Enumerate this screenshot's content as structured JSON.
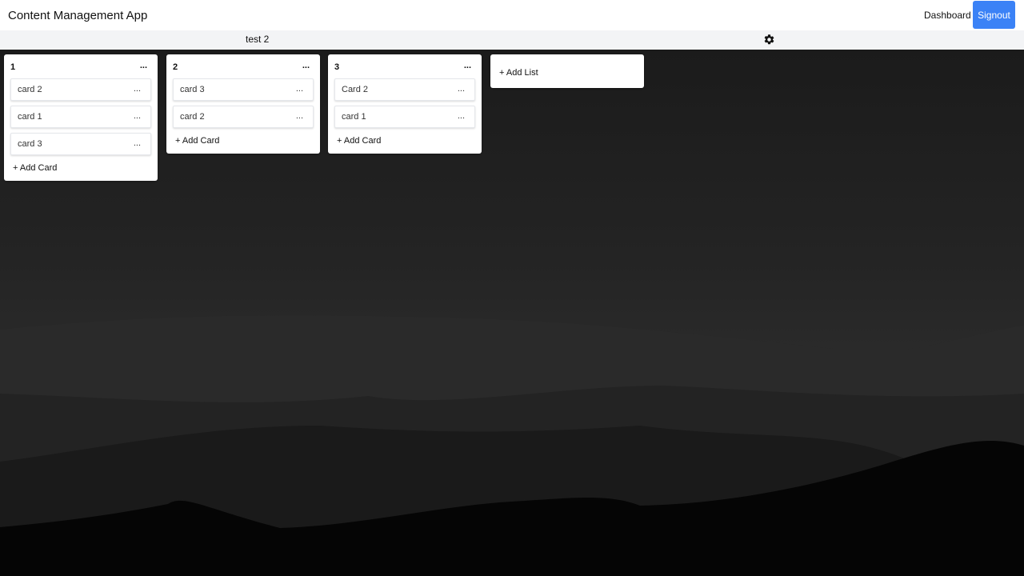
{
  "app": {
    "title": "Content Management App"
  },
  "nav": {
    "dashboard": "Dashboard",
    "signout": "Signout"
  },
  "board": {
    "name": "test 2",
    "settings_icon": "gear-icon"
  },
  "lists": [
    {
      "title": "1",
      "menu": "...",
      "cards": [
        {
          "title": "card 2",
          "menu": "..."
        },
        {
          "title": "card 1",
          "menu": "..."
        },
        {
          "title": "card 3",
          "menu": "..."
        }
      ],
      "add_card": "+ Add Card"
    },
    {
      "title": "2",
      "menu": "...",
      "cards": [
        {
          "title": "card 3",
          "menu": "..."
        },
        {
          "title": "card 2",
          "menu": "..."
        }
      ],
      "add_card": "+ Add Card"
    },
    {
      "title": "3",
      "menu": "...",
      "cards": [
        {
          "title": "Card 2",
          "menu": "..."
        },
        {
          "title": "card 1",
          "menu": "..."
        }
      ],
      "add_card": "+ Add Card"
    }
  ],
  "add_list": "+ Add List",
  "colors": {
    "accent": "#3b82f6",
    "subbar": "#f3f4f6"
  }
}
